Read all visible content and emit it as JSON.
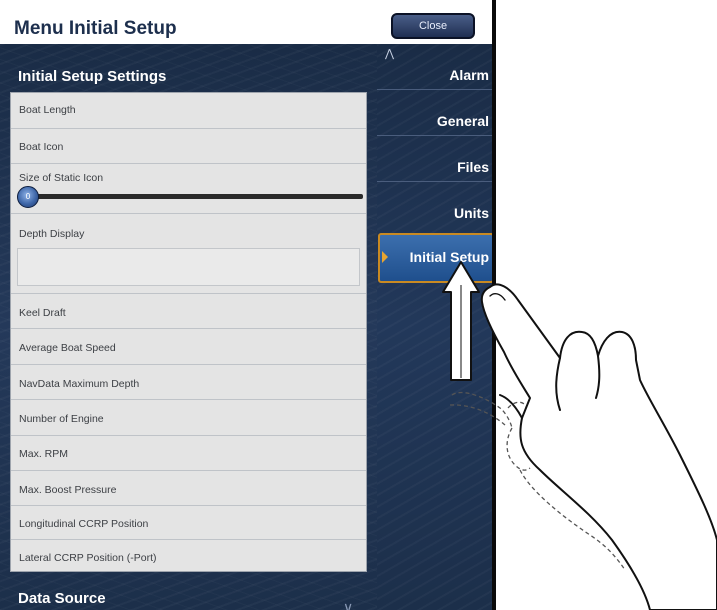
{
  "header": {
    "title": "Menu Initial Setup",
    "close_label": "Close"
  },
  "left_panel": {
    "section_title": "Initial Setup Settings",
    "rows": {
      "boat_length": "Boat Length",
      "boat_icon": "Boat Icon",
      "size_static_icon": "Size of Static Icon",
      "slider_value": "0",
      "depth_display": "Depth Display",
      "keel_draft": "Keel Draft",
      "avg_speed": "Average Boat Speed",
      "navdata_depth": "NavData Maximum Depth",
      "num_engine": "Number of Engine",
      "max_rpm": "Max. RPM",
      "max_boost": "Max. Boost Pressure",
      "long_ccrp": "Longitudinal CCRP Position",
      "lat_ccrp": "Lateral CCRP Position (-Port)"
    },
    "next_section": "Data Source"
  },
  "nav": {
    "items": [
      "Alarm",
      "General",
      "Files",
      "Units"
    ],
    "active": "Initial Setup"
  },
  "colors": {
    "panel": "#1c2f4a",
    "active_nav": "#2c5d9c",
    "active_border": "#c98a22"
  },
  "icons": {
    "scroll_up": "chevron-up-icon",
    "scroll_down": "chevron-down-icon",
    "gesture": "swipe-up-hand-icon"
  }
}
